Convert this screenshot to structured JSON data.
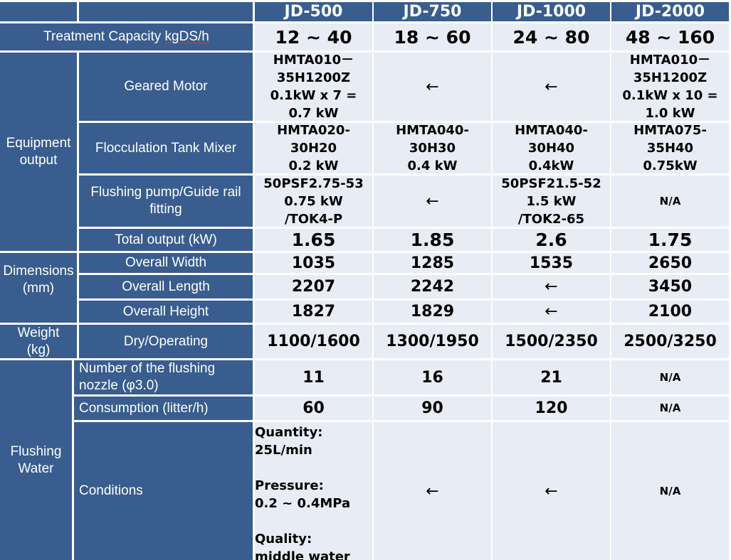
{
  "columns": [
    "JD-500",
    "JD-750",
    "JD-1000",
    "JD-2000"
  ],
  "rows": {
    "treatment_capacity": {
      "label_prefix": "Treatment Capacity ",
      "label_unit": "kgDS/h",
      "values": [
        "12 ~ 40",
        "18 ~ 60",
        "24 ~ 80",
        "48 ~ 160"
      ]
    },
    "equipment_output": {
      "group_label": "Equipment\noutput",
      "geared_motor": {
        "label": "Geared Motor",
        "values": [
          "HMTA010－\n35H1200Z\n0.1kW x 7 =\n0.7 kW",
          "←",
          "←",
          "HMTA010－\n35H1200Z\n0.1kW x 10 =\n1.0 kW"
        ]
      },
      "flocculation_tank_mixer": {
        "label": "Flocculation Tank Mixer",
        "values": [
          "HMTA020-\n30H20\n0.2 kW",
          "HMTA040-\n30H30\n0.4 kW",
          "HMTA040-\n30H40\n0.4kW",
          "HMTA075-\n35H40\n0.75kW"
        ]
      },
      "flushing_pump": {
        "label": "Flushing pump/Guide rail\nfitting",
        "values": [
          "50PSF2.75-53\n0.75 kW\n/TOK4-P",
          "←",
          "50PSF21.5-52\n1.5 kW\n/TOK2-65",
          "N/A"
        ]
      },
      "total_output": {
        "label": "Total output (kW)",
        "values": [
          "1.65",
          "1.85",
          "2.6",
          "1.75"
        ]
      }
    },
    "dimensions": {
      "group_label": "Dimensions\n(mm)",
      "overall_width": {
        "label": "Overall Width",
        "values": [
          "1035",
          "1285",
          "1535",
          "2650"
        ]
      },
      "overall_length": {
        "label": "Overall Length",
        "values": [
          "2207",
          "2242",
          "←",
          "3450"
        ]
      },
      "overall_height": {
        "label": "Overall Height",
        "values": [
          "1827",
          "1829",
          "←",
          "2100"
        ]
      }
    },
    "weight": {
      "group_label": "Weight\n(kg)",
      "dry_operating": {
        "label": "Dry/Operating",
        "values": [
          "1100/1600",
          "1300/1950",
          "1500/2350",
          "2500/3250"
        ]
      }
    },
    "flushing_water": {
      "group_label": "Flushing\nWater",
      "nozzle_count": {
        "label": "Number of the flushing\nnozzle (φ3.0)",
        "values": [
          "11",
          "16",
          "21",
          "N/A"
        ]
      },
      "consumption": {
        "label": "Consumption (litter/h)",
        "values": [
          "60",
          "90",
          "120",
          "N/A"
        ]
      },
      "conditions": {
        "label": "Conditions",
        "values": [
          "Quantity:\n25L/min\n\nPressure:\n0.2 ~ 0.4MPa\n\nQuality:\nmiddle water",
          "←",
          "←",
          "N/A"
        ]
      }
    }
  }
}
